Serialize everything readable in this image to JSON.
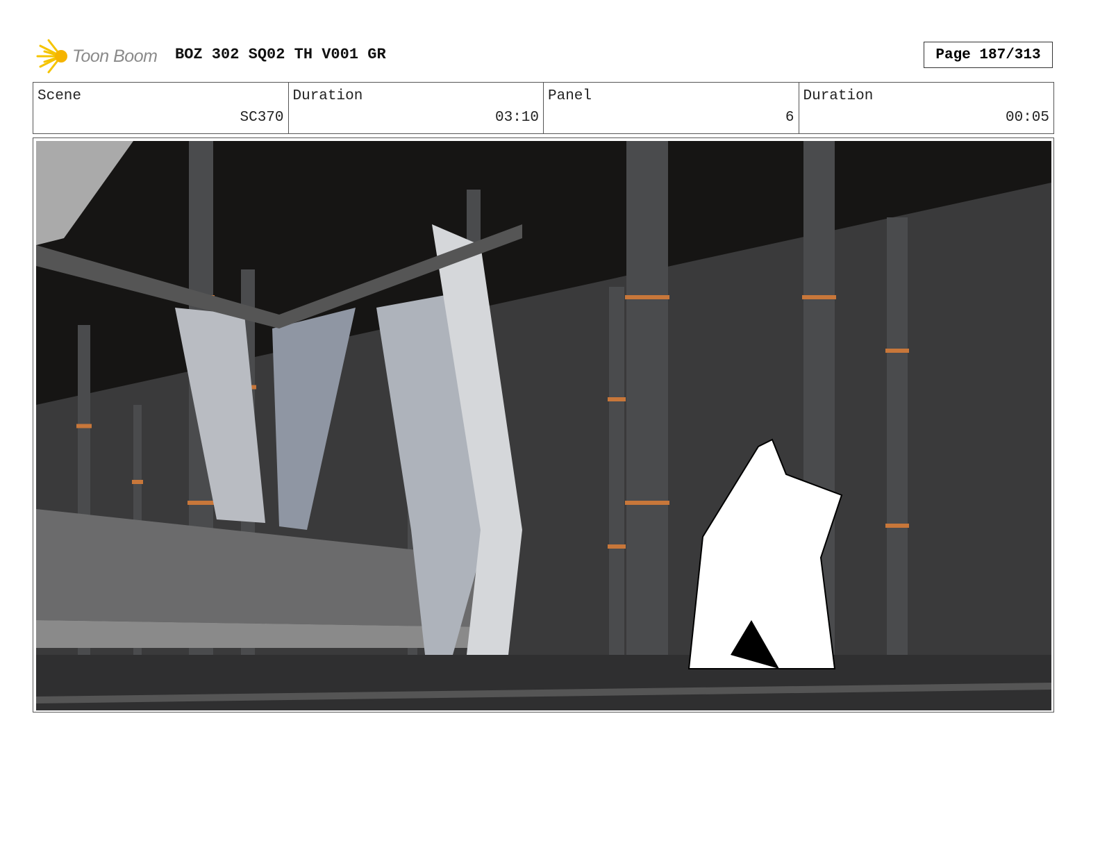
{
  "header": {
    "logo_text": "Toon Boom",
    "project_title": "BOZ 302 SQ02 TH V001 GR",
    "page_label": "Page 187/313"
  },
  "info": {
    "scene_label": "Scene",
    "scene_value": "SC370",
    "scene_duration_label": "Duration",
    "scene_duration_value": "03:10",
    "panel_label": "Panel",
    "panel_value": "6",
    "panel_duration_label": "Duration",
    "panel_duration_value": "00:05"
  },
  "colors": {
    "accent_orange": "#c8773a",
    "logo_yellow": "#f5c400"
  }
}
